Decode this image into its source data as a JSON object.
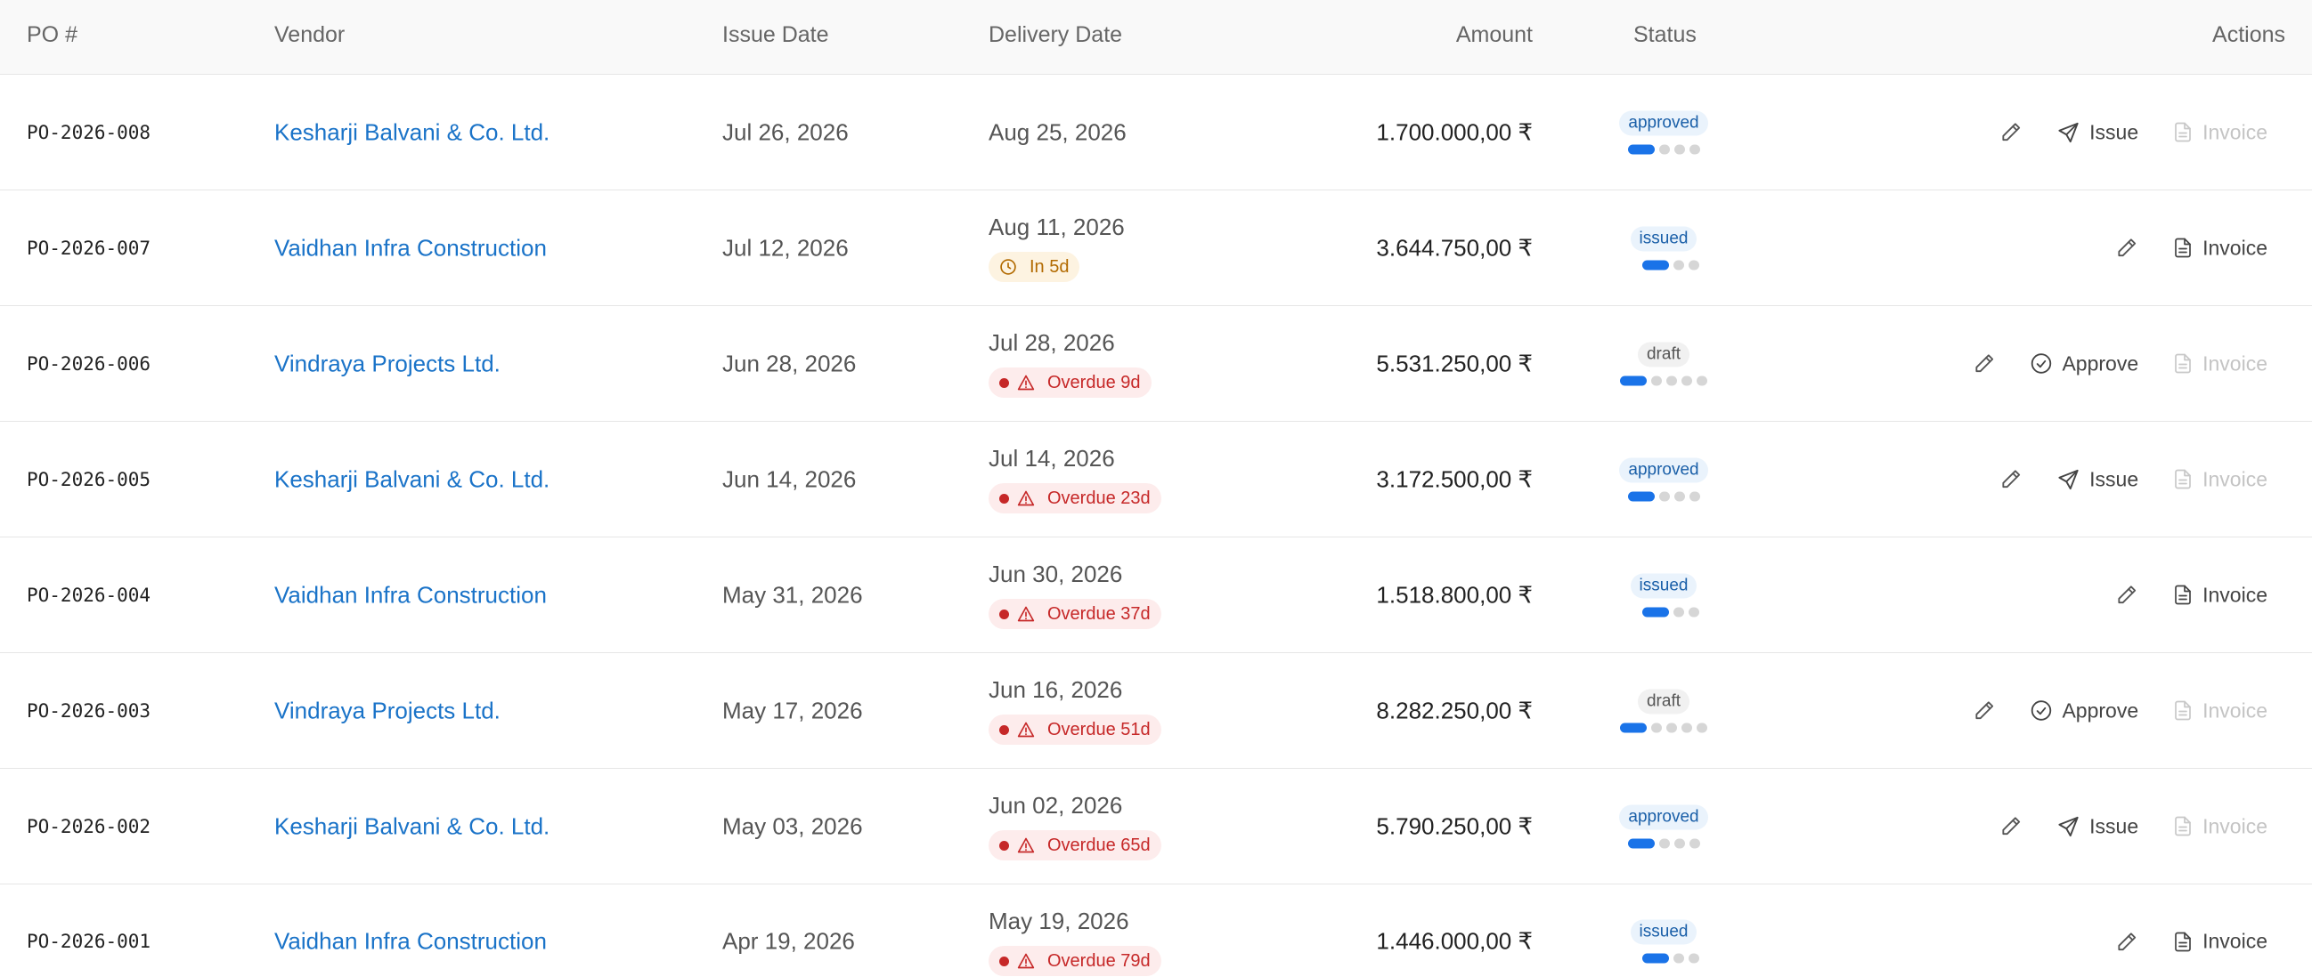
{
  "header": {
    "po": "PO #",
    "vendor": "Vendor",
    "issue_date": "Issue Date",
    "delivery_date": "Delivery Date",
    "amount": "Amount",
    "status": "Status",
    "actions": "Actions"
  },
  "rows": [
    {
      "po": "PO-2026-008",
      "vendor": "Kesharji Balvani & Co. Ltd.",
      "issue_date": "Jul 26, 2026",
      "delivery_date": "Aug 25, 2026",
      "chip": "",
      "amount": "1.700.000,00 ₹",
      "status": "approved",
      "progress": "1 of 4",
      "actions": [
        "Issue",
        "Invoice"
      ]
    },
    {
      "po": "PO-2026-007",
      "vendor": "Vaidhan Infra Construction",
      "issue_date": "Jul 12, 2026",
      "delivery_date": "Aug 11, 2026",
      "chip": "In 5d",
      "amount": "3.644.750,00 ₹",
      "status": "issued",
      "progress": "1 of 3",
      "actions": [
        "Invoice"
      ]
    },
    {
      "po": "PO-2026-006",
      "vendor": "Vindraya Projects Ltd.",
      "issue_date": "Jun 28, 2026",
      "delivery_date": "Jul 28, 2026",
      "chip": "Overdue 9d",
      "amount": "5.531.250,00 ₹",
      "status": "draft",
      "progress": "1 of 5",
      "actions": [
        "Approve",
        "Invoice"
      ]
    },
    {
      "po": "PO-2026-005",
      "vendor": "Kesharji Balvani & Co. Ltd.",
      "issue_date": "Jun 14, 2026",
      "delivery_date": "Jul 14, 2026",
      "chip": "Overdue 23d",
      "amount": "3.172.500,00 ₹",
      "status": "approved",
      "progress": "1 of 4",
      "actions": [
        "Issue",
        "Invoice"
      ]
    },
    {
      "po": "PO-2026-004",
      "vendor": "Vaidhan Infra Construction",
      "issue_date": "May 31, 2026",
      "delivery_date": "Jun 30, 2026",
      "chip": "Overdue 37d",
      "amount": "1.518.800,00 ₹",
      "status": "issued",
      "progress": "1 of 3",
      "actions": [
        "Invoice"
      ]
    },
    {
      "po": "PO-2026-003",
      "vendor": "Vindraya Projects Ltd.",
      "issue_date": "May 17, 2026",
      "delivery_date": "Jun 16, 2026",
      "chip": "Overdue 51d",
      "amount": "8.282.250,00 ₹",
      "status": "draft",
      "progress": "1 of 5",
      "actions": [
        "Approve",
        "Invoice"
      ]
    },
    {
      "po": "PO-2026-002",
      "vendor": "Kesharji Balvani & Co. Ltd.",
      "issue_date": "May 03, 2026",
      "delivery_date": "Jun 02, 2026",
      "chip": "Overdue 65d",
      "amount": "5.790.250,00 ₹",
      "status": "approved",
      "progress": "1 of 4",
      "actions": [
        "Issue",
        "Invoice"
      ]
    },
    {
      "po": "PO-2026-001",
      "vendor": "Vaidhan Infra Construction",
      "issue_date": "Apr 19, 2026",
      "delivery_date": "May 19, 2026",
      "chip": "Overdue 79d",
      "amount": "1.446.000,00 ₹",
      "status": "issued",
      "progress": "1 of 3",
      "actions": [
        "Invoice"
      ]
    }
  ],
  "icons": {
    "edit": "pencil-icon",
    "issue": "send-icon",
    "approve": "check-circle-icon",
    "invoice": "document-icon",
    "due_soon": "clock-icon",
    "overdue": "warning-icon"
  },
  "colors": {
    "link": "#1a73c8",
    "progress": "#1a73e8",
    "overdue": "#c62828",
    "due_soon": "#b26a00"
  }
}
